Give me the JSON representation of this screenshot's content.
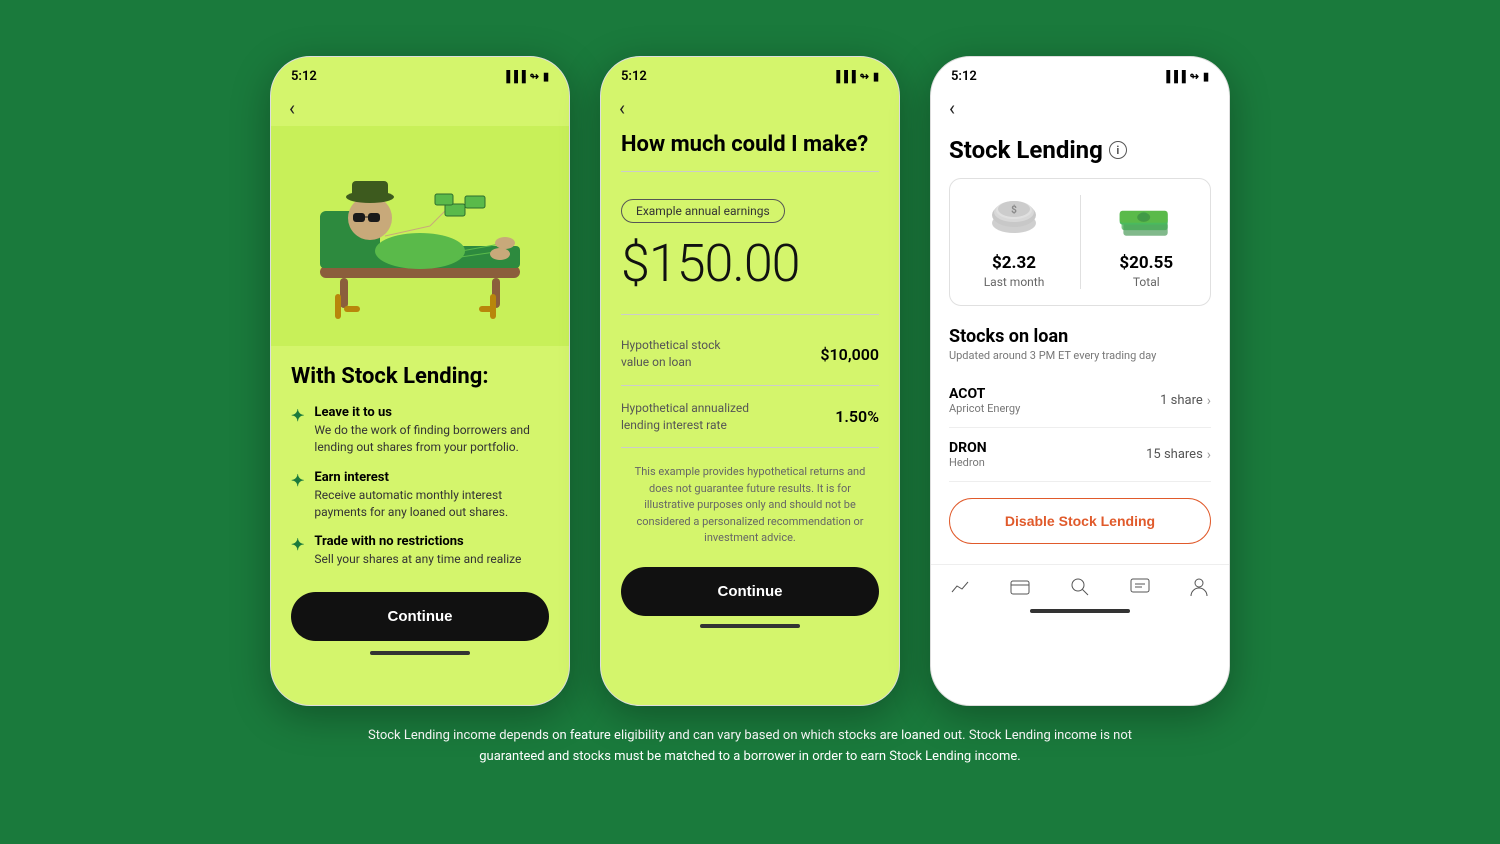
{
  "page": {
    "background_color": "#1a7a3c",
    "footer_text": "Stock Lending income depends on feature eligibility and can vary based on which stocks are loaned out. Stock Lending income is not guaranteed and stocks must be matched to a borrower in order to earn Stock Lending income."
  },
  "phone1": {
    "status_time": "5:12",
    "back_label": "‹",
    "title": "With Stock Lending:",
    "features": [
      {
        "title": "Leave it to us",
        "description": "We do the work of finding borrowers and lending out shares from your portfolio."
      },
      {
        "title": "Earn interest",
        "description": "Receive automatic monthly interest payments for any loaned out shares."
      },
      {
        "title": "Trade with no restrictions",
        "description": "Sell your shares at any time and realize"
      }
    ],
    "continue_label": "Continue"
  },
  "phone2": {
    "status_time": "5:12",
    "back_label": "‹",
    "title": "How much could I make?",
    "badge_label": "Example annual earnings",
    "amount": "$150.00",
    "row1_label": "Hypothetical stock\nvalue on loan",
    "row1_value": "$10,000",
    "row2_label": "Hypothetical annualized\nlending interest rate",
    "row2_value": "1.50%",
    "disclaimer": "This example provides hypothetical returns and does not guarantee future results. It is for illustrative purposes only and should not be considered a personalized recommendation or investment advice.",
    "continue_label": "Continue"
  },
  "phone3": {
    "status_time": "5:12",
    "back_label": "‹",
    "title": "Stock Lending",
    "last_month_label": "Last month",
    "last_month_amount": "$2.32",
    "total_label": "Total",
    "total_amount": "$20.55",
    "stocks_on_loan_title": "Stocks on loan",
    "stocks_update": "Updated around 3 PM ET every trading day",
    "stocks": [
      {
        "ticker": "ACOT",
        "name": "Apricot Energy",
        "shares": "1 share"
      },
      {
        "ticker": "DRON",
        "name": "Hedron",
        "shares": "15 shares"
      }
    ],
    "disable_label": "Disable Stock Lending",
    "nav_icons": [
      "chart",
      "card",
      "search",
      "chat",
      "person"
    ]
  }
}
